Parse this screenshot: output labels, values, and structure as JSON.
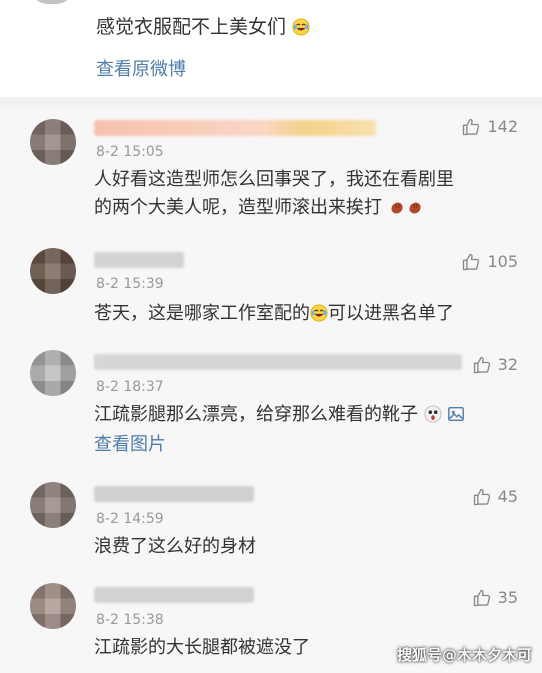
{
  "top_post": {
    "text": "感觉衣服配不上美女们",
    "emoji_icon": "laughing-tears-icon",
    "view_original": "查看原微博"
  },
  "comments": [
    {
      "time": "8-2 15:05",
      "likes": "142",
      "lines": [
        "人好看这造型师怎么回事哭了，我还在看剧里",
        "的两个大美人呢，造型师滚出来挨打"
      ],
      "emoji_icons": [
        "punch-icon",
        "punch-icon"
      ],
      "avatar_color": "#8b7b74",
      "name_color": "#f6c6b6"
    },
    {
      "time": "8-2 15:39",
      "likes": "105",
      "lines": [
        "苍天，这是哪家工作室配的",
        "可以进黑名单了"
      ],
      "emoji_icons": [
        "laughing-tears-icon"
      ],
      "avatar_color": "#6f5a4e",
      "name_color": "#cfcfcf"
    },
    {
      "time": "8-2 18:37",
      "likes": "32",
      "lines": [
        "江疏影腿那么漂亮，给穿那么难看的靴子"
      ],
      "emoji_icons": [
        "shocked-face-icon",
        "image-icon"
      ],
      "view_image": "查看图片",
      "avatar_color": "#b7b7b7",
      "name_color": "#d2d2d2"
    },
    {
      "time": "8-2 14:59",
      "likes": "45",
      "lines": [
        "浪费了这么好的身材"
      ],
      "emoji_icons": [],
      "avatar_color": "#8e7f7a",
      "name_color": "#cdcdcd"
    },
    {
      "time": "8-2 15:38",
      "likes": "35",
      "lines": [
        "江疏影的大长腿都被遮没了"
      ],
      "emoji_icons": [],
      "avatar_color": "#a58f88",
      "name_color": "#cfcfcf"
    }
  ],
  "watermark": "搜狐号@木木夕木可",
  "colors": {
    "link": "#507daf",
    "time": "#999999",
    "text": "#333333",
    "background": "#f7f7f7"
  }
}
